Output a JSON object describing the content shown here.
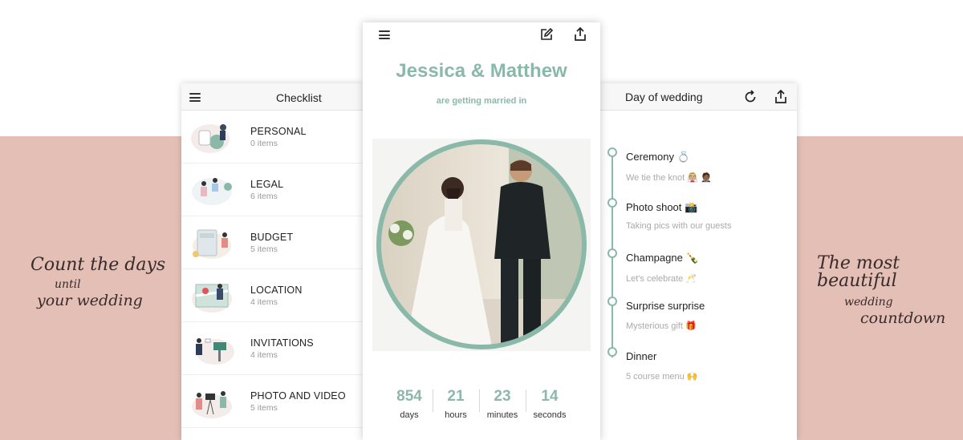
{
  "taglines": {
    "left": [
      "Count the days",
      "until",
      "your wedding"
    ],
    "right": [
      "The most beautiful",
      "wedding",
      "countdown"
    ]
  },
  "checklist": {
    "title": "Checklist",
    "items": [
      {
        "label": "PERSONAL",
        "count": "0 items"
      },
      {
        "label": "LEGAL",
        "count": "6 items"
      },
      {
        "label": "BUDGET",
        "count": "5 items"
      },
      {
        "label": "LOCATION",
        "count": "4 items"
      },
      {
        "label": "INVITATIONS",
        "count": "4 items"
      },
      {
        "label": "PHOTO AND VIDEO",
        "count": "5 items"
      }
    ]
  },
  "countdown": {
    "couple": "Jessica & Matthew",
    "subtitle": "are getting married in",
    "units": [
      {
        "value": "854",
        "label": "days"
      },
      {
        "value": "21",
        "label": "hours"
      },
      {
        "value": "23",
        "label": "minutes"
      },
      {
        "value": "14",
        "label": "seconds"
      }
    ]
  },
  "day_of_wedding": {
    "title": "Day of wedding",
    "events": [
      {
        "title": "Ceremony 💍",
        "subtitle": "We tie the knot 👰🏼 🤵🏾"
      },
      {
        "title": "Photo shoot 📸",
        "subtitle": "Taking pics with our guests"
      },
      {
        "title": "Champagne 🍾",
        "subtitle": "Let's celebrate 🥂"
      },
      {
        "title": "Surprise surprise",
        "subtitle": "Mysterious gift 🎁"
      },
      {
        "title": "Dinner",
        "subtitle": "5 course menu 🙌"
      }
    ]
  },
  "colors": {
    "accent": "#8bb9a9",
    "band": "#e3bfb6"
  },
  "icons": [
    "menu-icon",
    "edit-icon",
    "share-icon",
    "refresh-icon"
  ]
}
